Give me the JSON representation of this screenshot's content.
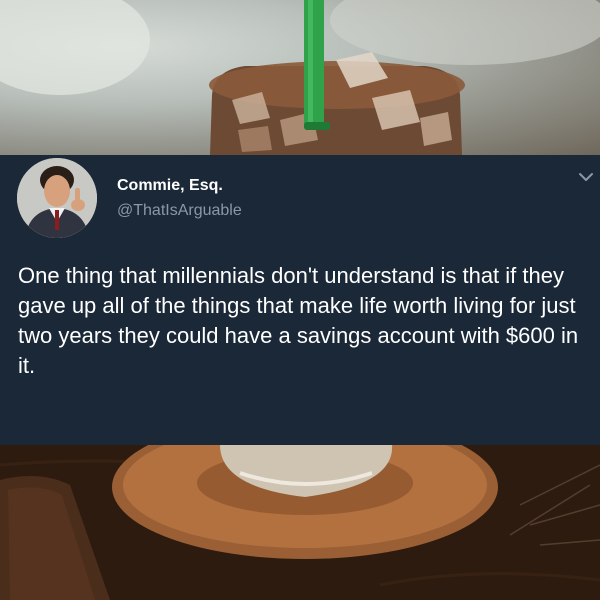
{
  "tweet": {
    "author_name": "Commie, Esq.",
    "author_handle": "@ThatIsArguable",
    "text": "One thing that millennials don't understand is that if they gave up all of the things that make life worth living for just two years they could have a savings account with $600 in it."
  },
  "icons": {
    "menu": "chevron-down-icon"
  },
  "colors": {
    "card_background": "#1b2838",
    "text_primary": "#ffffff",
    "text_secondary": "#8899a6"
  }
}
